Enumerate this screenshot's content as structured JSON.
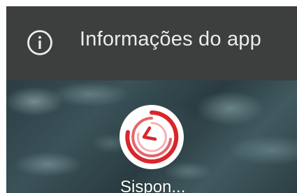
{
  "popup": {
    "info_icon": "info-circle-icon",
    "label": "Informações do app"
  },
  "home": {
    "app": {
      "icon": "clock-swirl-app-icon",
      "label": "Sispon..."
    }
  },
  "colors": {
    "popup_background": "#3d3e3e",
    "popup_text": "#ececec",
    "app_icon_red": "#d9262b"
  }
}
